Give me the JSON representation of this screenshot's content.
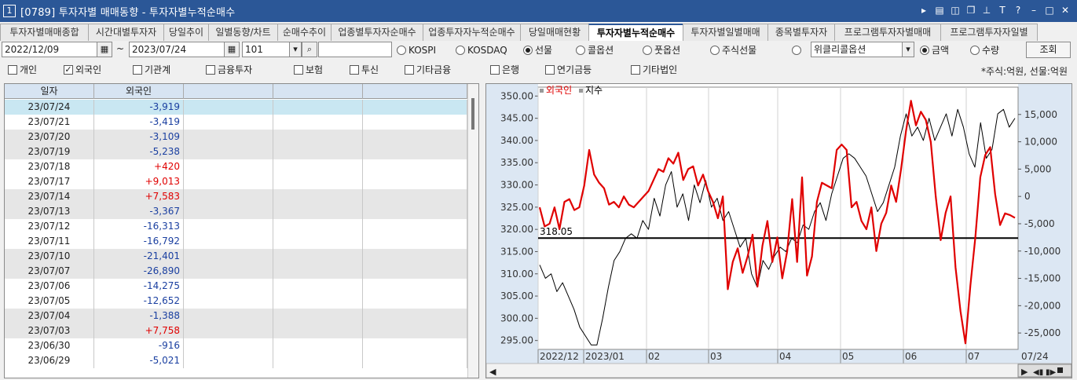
{
  "window": {
    "num": "1",
    "title": "[0789] 투자자별 매매동향 - 투자자별누적순매수"
  },
  "tabs": [
    "투자자별매매종합",
    "시간대별투자자",
    "당일추이",
    "일별동향/차트",
    "순매수추이",
    "업종별투자자순매수",
    "업종투자자누적순매수",
    "당일매매현황",
    "투자자별누적순매수",
    "투자자별일별매매",
    "종목별투자자",
    "프로그램투자자별매매",
    "프로그램투자자일별"
  ],
  "active_tab": 8,
  "controls": {
    "start_date": "2022/12/09",
    "tilde": "~",
    "end_date": "2023/07/24",
    "code": "101",
    "kospi": "KOSPI",
    "kosdaq": "KOSDAQ",
    "futures": "선물",
    "call": "콜옵션",
    "put": "풋옵션",
    "stock_futures": "주식선물",
    "option_select": "위클리콜옵션",
    "amount": "금액",
    "quantity": "수량",
    "query": "조회"
  },
  "checks": [
    {
      "label": "개인",
      "on": false
    },
    {
      "label": "외국인",
      "on": true
    },
    {
      "label": "기관계",
      "on": false
    },
    {
      "label": "금융투자",
      "on": false
    },
    {
      "label": "보험",
      "on": false
    },
    {
      "label": "투신",
      "on": false
    },
    {
      "label": "기타금융",
      "on": false
    },
    {
      "label": "은행",
      "on": false
    },
    {
      "label": "연기금등",
      "on": false
    },
    {
      "label": "기타법인",
      "on": false
    }
  ],
  "unit_text": "*주식:억원, 선물:억원",
  "table": {
    "headers": [
      "일자",
      "외국인"
    ],
    "rows": [
      [
        "23/07/24",
        "-3,919"
      ],
      [
        "23/07/21",
        "-3,419"
      ],
      [
        "23/07/20",
        "-3,109"
      ],
      [
        "23/07/19",
        "-5,238"
      ],
      [
        "23/07/18",
        "+420"
      ],
      [
        "23/07/17",
        "+9,013"
      ],
      [
        "23/07/14",
        "+7,583"
      ],
      [
        "23/07/13",
        "-3,367"
      ],
      [
        "23/07/12",
        "-16,313"
      ],
      [
        "23/07/11",
        "-16,792"
      ],
      [
        "23/07/10",
        "-21,401"
      ],
      [
        "23/07/07",
        "-26,890"
      ],
      [
        "23/07/06",
        "-14,275"
      ],
      [
        "23/07/05",
        "-12,652"
      ],
      [
        "23/07/04",
        "-1,388"
      ],
      [
        "23/07/03",
        "+7,758"
      ],
      [
        "23/06/30",
        "-916"
      ],
      [
        "23/06/29",
        "-5,021"
      ]
    ]
  },
  "chart_data": {
    "type": "line",
    "legend": [
      "외국인",
      "지수"
    ],
    "colors": {
      "foreign": "#e00000",
      "index": "#000000",
      "positive": "#e00000",
      "negative": "#1a3fa0"
    },
    "left_axis": {
      "ticks": [
        "295.00",
        "300.00",
        "305.00",
        "310.00",
        "315.00",
        "320.00",
        "325.00",
        "330.00",
        "335.00",
        "340.00",
        "345.00",
        "350.00"
      ],
      "ylim": [
        293,
        352
      ]
    },
    "right_axis": {
      "ticks": [
        "-25,000",
        "-20,000",
        "-15,000",
        "-10,000",
        "-5,000",
        "0",
        "5,000",
        "10,000",
        "15,000"
      ],
      "ylim": [
        -28000,
        20000
      ]
    },
    "x_ticks": [
      "2022/12",
      "2023/01",
      "02",
      "03",
      "04",
      "05",
      "06",
      "07"
    ],
    "x_end_label": "07/24",
    "hline": {
      "label": "318.05",
      "value": 318.05
    },
    "index_series": [
      312,
      309,
      310,
      306,
      308,
      305,
      302,
      298,
      296,
      294,
      294,
      300,
      307,
      313,
      315,
      318,
      319,
      318,
      322,
      320,
      327,
      323,
      330,
      333,
      325,
      328,
      322,
      330,
      326,
      331,
      325,
      327,
      322,
      324,
      320,
      316,
      318,
      310,
      307,
      313,
      311,
      314,
      316,
      315,
      318,
      317,
      321,
      320,
      324,
      326,
      322,
      328,
      332,
      336,
      337,
      336,
      334,
      332,
      328,
      324,
      326,
      330,
      334,
      341,
      346,
      341,
      343,
      340,
      345,
      340,
      343,
      346,
      341,
      347,
      343,
      337,
      334,
      344,
      336,
      338,
      346,
      347,
      343,
      345
    ],
    "foreign_series": [
      -2000,
      -5500,
      -5000,
      -2000,
      -6000,
      -1000,
      -500,
      -2500,
      -2000,
      2000,
      8500,
      4000,
      2500,
      1500,
      -1500,
      -1000,
      -2000,
      0,
      -1500,
      -2000,
      -1000,
      0,
      1000,
      3000,
      5000,
      4500,
      7000,
      6000,
      8000,
      3000,
      5000,
      5500,
      2000,
      4000,
      1000,
      -1000,
      -4000,
      0,
      -17000,
      -12000,
      -9500,
      -14000,
      -11000,
      -7000,
      -16500,
      -9000,
      -4500,
      -12000,
      -7500,
      -15000,
      -10000,
      -500,
      -12000,
      3500,
      -14500,
      -11000,
      -1000,
      2500,
      2000,
      1500,
      8500,
      9500,
      8500,
      -2000,
      -1000,
      -4500,
      -6000,
      -2000,
      -10000,
      -5000,
      -3000,
      2000,
      -1000,
      5000,
      12000,
      17500,
      13000,
      15500,
      14000,
      10000,
      0,
      -8000,
      -3000,
      0,
      -13000,
      -21000,
      -26890,
      -16313,
      -7500,
      3500,
      7583,
      9013,
      420,
      -5238,
      -3109,
      -3419,
      -3919
    ]
  },
  "scroll": {
    "left": "◀",
    "right": "▶"
  }
}
